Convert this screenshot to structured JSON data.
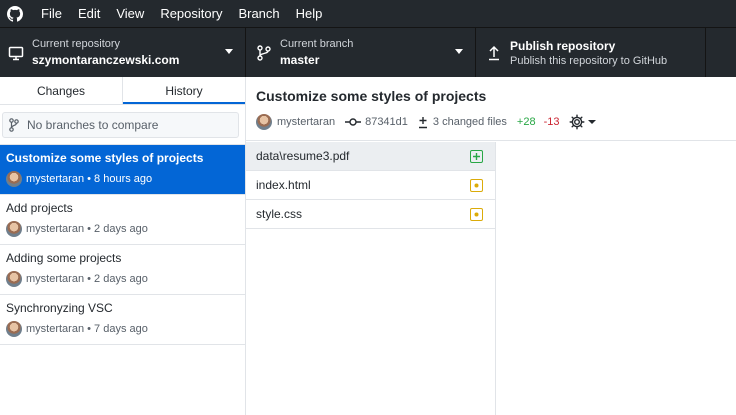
{
  "menubar": {
    "items": [
      "File",
      "Edit",
      "View",
      "Repository",
      "Branch",
      "Help"
    ]
  },
  "toolbar": {
    "repo": {
      "label": "Current repository",
      "value": "szymontaranczewski.com"
    },
    "branch": {
      "label": "Current branch",
      "value": "master"
    },
    "publish": {
      "label": "Publish repository",
      "sub": "Publish this repository to GitHub"
    }
  },
  "sidebar": {
    "tabs": [
      "Changes",
      "History"
    ],
    "active_tab": "History",
    "branch_filter_placeholder": "No branches to compare",
    "commits": [
      {
        "title": "Customize some styles of projects",
        "author": "mystertaran",
        "time": "8 hours ago"
      },
      {
        "title": "Add projects",
        "author": "mystertaran",
        "time": "2 days ago"
      },
      {
        "title": "Adding some projects",
        "author": "mystertaran",
        "time": "2 days ago"
      },
      {
        "title": "Synchronyzing VSC",
        "author": "mystertaran",
        "time": "7 days ago"
      }
    ]
  },
  "commit_detail": {
    "title": "Customize some styles of projects",
    "author": "mystertaran",
    "sha": "87341d1",
    "changed_files": "3 changed files",
    "additions": "+28",
    "deletions": "-13"
  },
  "files": [
    {
      "name": "data\\resume3.pdf",
      "status": "added"
    },
    {
      "name": "index.html",
      "status": "modified"
    },
    {
      "name": "style.css",
      "status": "modified"
    }
  ],
  "colors": {
    "chrome": "#24292e",
    "accent": "#0366d6",
    "added": "#28a745",
    "modified": "#dbab09",
    "deleted": "#cb2431"
  }
}
